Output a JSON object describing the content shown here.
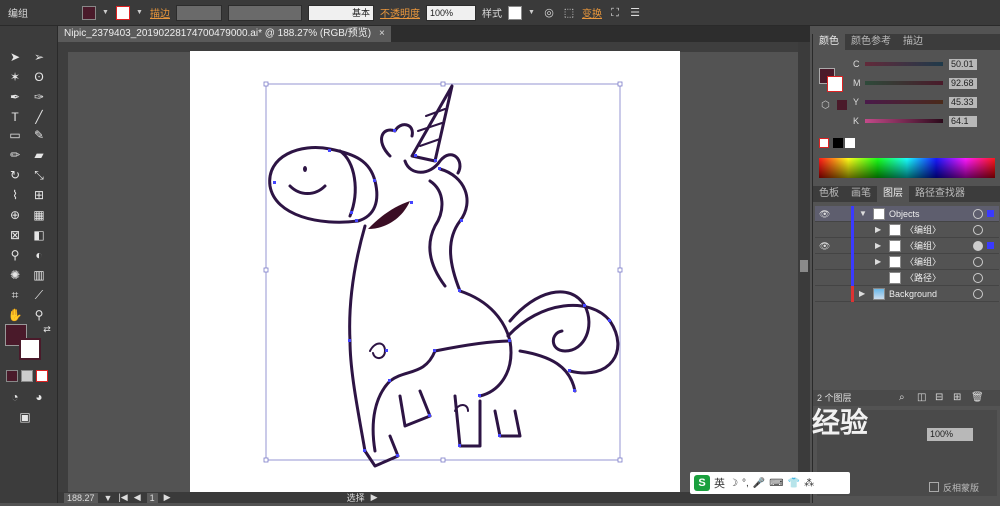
{
  "control": {
    "mode_label": "编组",
    "stroke_label": "描边",
    "stroke_style": "基本",
    "opacity_label": "不透明度",
    "opacity_value": "100%",
    "style_label": "样式",
    "transform_label": "变换"
  },
  "document": {
    "tab_title": "Nipic_2379403_20190228174700479000.ai* @ 188.27% (RGB/预览)",
    "close": "×"
  },
  "status": {
    "zoom": "188.27",
    "page": "1",
    "selection_label": "选择"
  },
  "color_panel": {
    "tabs": [
      "颜色",
      "颜色参考",
      "描边"
    ],
    "channels": [
      {
        "name": "C",
        "value": "50.01"
      },
      {
        "name": "M",
        "value": "92.68"
      },
      {
        "name": "Y",
        "value": "45.33"
      },
      {
        "name": "K",
        "value": "64.1"
      }
    ]
  },
  "layers_panel": {
    "tabs": [
      "色板",
      "画笔",
      "图层",
      "路径查找器"
    ],
    "layers": [
      {
        "name": "Objects"
      },
      {
        "name": "〈编组〉"
      },
      {
        "name": "〈编组〉"
      },
      {
        "name": "〈编组〉"
      },
      {
        "name": "〈路径〉"
      },
      {
        "name": "Background"
      }
    ],
    "footer": "2 个图层",
    "mask_label": "反相蒙版"
  },
  "ime": {
    "lang": "英"
  },
  "watermark": "经验",
  "colors": {
    "fill": "#4a1a2a",
    "selection": "#3a3aff",
    "accent_orange": "#e8963c"
  }
}
